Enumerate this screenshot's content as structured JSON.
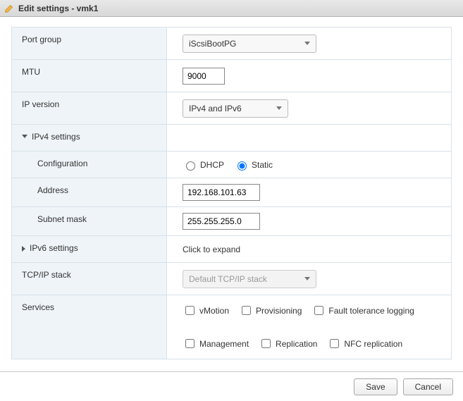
{
  "title": "Edit settings - vmk1",
  "labels": {
    "port_group": "Port group",
    "mtu": "MTU",
    "ip_version": "IP version",
    "ipv4_settings": "IPv4 settings",
    "configuration": "Configuration",
    "address": "Address",
    "subnet_mask": "Subnet mask",
    "ipv6_settings": "IPv6 settings",
    "tcpip_stack": "TCP/IP stack",
    "services": "Services"
  },
  "port_group": {
    "value": "iScsiBootPG"
  },
  "mtu": {
    "value": "9000"
  },
  "ip_version": {
    "value": "IPv4 and IPv6"
  },
  "ipv4": {
    "config": {
      "dhcp_label": "DHCP",
      "static_label": "Static",
      "selected": "static"
    },
    "address": "192.168.101.63",
    "subnet_mask": "255.255.255.0"
  },
  "ipv6": {
    "hint": "Click to expand"
  },
  "tcpip_stack": {
    "value": "Default TCP/IP stack",
    "disabled": true
  },
  "services": {
    "vmotion": "vMotion",
    "provisioning": "Provisioning",
    "fault_tolerance": "Fault tolerance logging",
    "management": "Management",
    "replication": "Replication",
    "nfc_replication": "NFC replication"
  },
  "buttons": {
    "save": "Save",
    "cancel": "Cancel"
  }
}
